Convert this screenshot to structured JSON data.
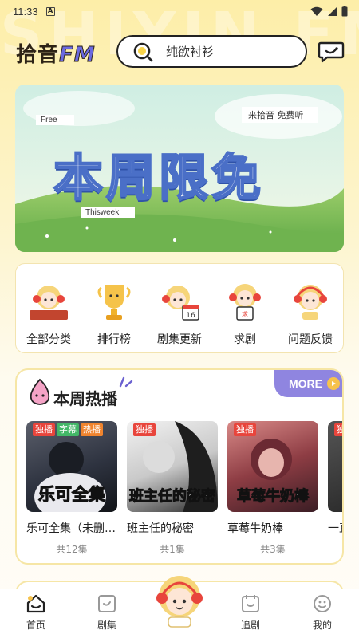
{
  "status": {
    "time": "11:33",
    "notification_badge": "A"
  },
  "header": {
    "logo_main": "拾音",
    "logo_fm": "FM",
    "watermark": "SHIYIN FM",
    "search_placeholder": "纯欲衬衫"
  },
  "banner": {
    "title": "本周限免",
    "tag_free": "Free",
    "tag_thisweek": "Thisweek",
    "tag_listen": "来拾音 免费听"
  },
  "categories": [
    {
      "label": "全部分类",
      "icon": "books-girl-icon"
    },
    {
      "label": "排行榜",
      "icon": "trophy-icon"
    },
    {
      "label": "剧集更新",
      "icon": "calendar-girl-icon"
    },
    {
      "label": "求剧",
      "icon": "request-girl-icon"
    },
    {
      "label": "问题反馈",
      "icon": "feedback-girl-icon"
    }
  ],
  "hot_section": {
    "title": "本周热播",
    "more_label": "MORE",
    "items": [
      {
        "name": "乐可全集（未删…",
        "episodes": "共12集",
        "cover_title": "乐可全集",
        "badges": [
          "独播",
          "字幕",
          "热播"
        ]
      },
      {
        "name": "班主任的秘密",
        "episodes": "共1集",
        "cover_title": "班主任的秘密",
        "badges": [
          "独播"
        ]
      },
      {
        "name": "草莓牛奶棒",
        "episodes": "共3集",
        "cover_title": "草莓牛奶棒",
        "badges": [
          "独播"
        ]
      },
      {
        "name": "一直",
        "episodes": "",
        "cover_title": "",
        "badges": [
          "独"
        ]
      }
    ]
  },
  "nav": {
    "items": [
      {
        "label": "首页",
        "icon": "home-icon",
        "active": true
      },
      {
        "label": "剧集",
        "icon": "episodes-icon",
        "active": false
      },
      {
        "label": "追剧",
        "icon": "follow-icon",
        "active": false
      },
      {
        "label": "我的",
        "icon": "profile-icon",
        "active": false
      }
    ]
  },
  "colors": {
    "accent_purple": "#8f85e0",
    "badge_red": "#e8453c",
    "badge_green": "#43b767",
    "badge_orange": "#f0842e",
    "bg_yellow": "#fdeea8"
  }
}
